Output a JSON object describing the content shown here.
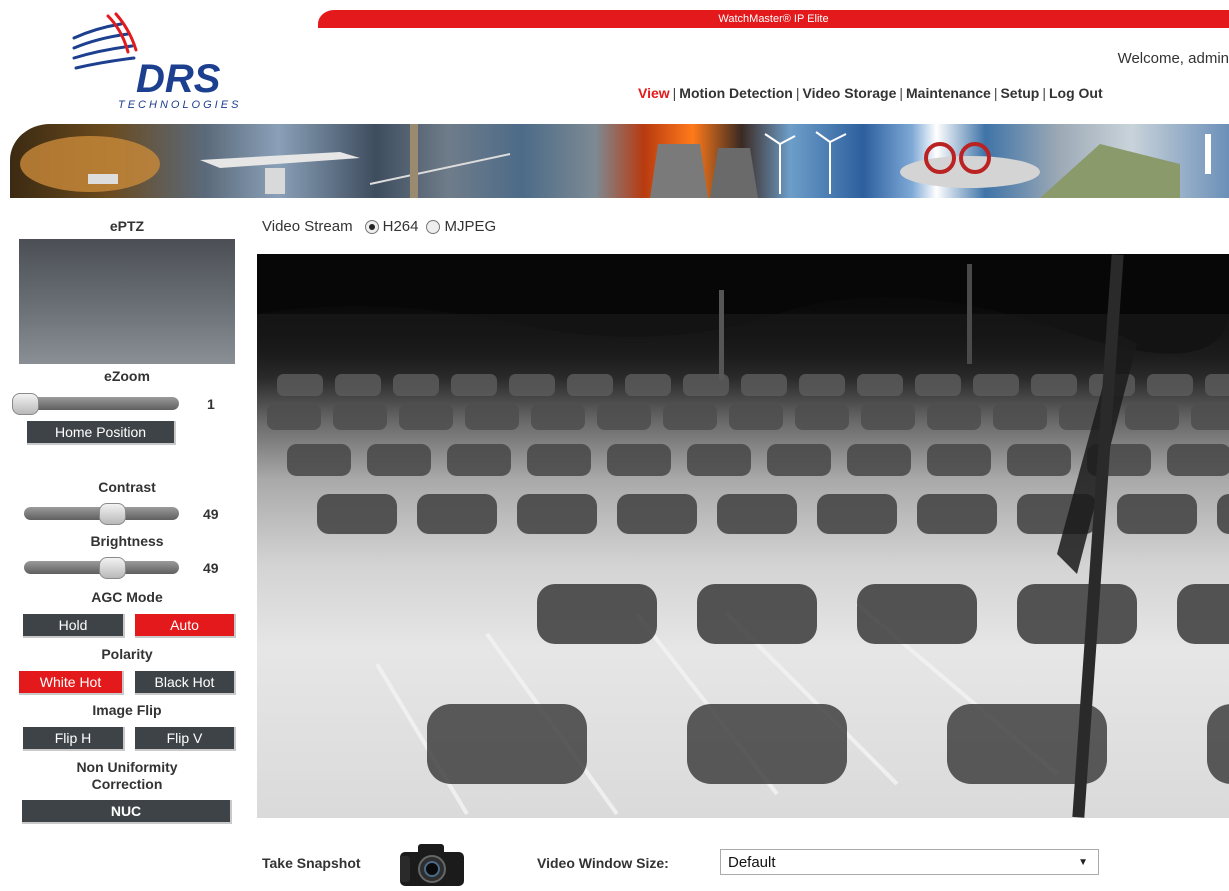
{
  "header": {
    "app_title": "WatchMaster® IP Elite",
    "welcome_text": "Welcome, admin",
    "logo_text": "DRS",
    "logo_subtext": "TECHNOLOGIES",
    "nav": [
      {
        "label": "View",
        "active": true
      },
      {
        "label": "Motion Detection",
        "active": false
      },
      {
        "label": "Video Storage",
        "active": false
      },
      {
        "label": "Maintenance",
        "active": false
      },
      {
        "label": "Setup",
        "active": false
      },
      {
        "label": "Log Out",
        "active": false
      }
    ],
    "nav_separator": "|"
  },
  "left_panel": {
    "eptz_label": "ePTZ",
    "ezoom": {
      "label": "eZoom",
      "value": "1",
      "level": 0.0
    },
    "home_button": "Home Position",
    "contrast": {
      "label": "Contrast",
      "value": "49",
      "level": 0.49
    },
    "brightness": {
      "label": "Brightness",
      "value": "49",
      "level": 0.49
    },
    "agc": {
      "label": "AGC Mode",
      "options": [
        "Hold",
        "Auto"
      ],
      "selected": "Auto"
    },
    "polarity": {
      "label": "Polarity",
      "options": [
        "White Hot",
        "Black Hot"
      ],
      "selected": "White Hot"
    },
    "image_flip": {
      "label": "Image Flip",
      "options": [
        "Flip H",
        "Flip V"
      ]
    },
    "nuc": {
      "label_line1": "Non Uniformity",
      "label_line2": "Correction",
      "button": "NUC"
    }
  },
  "video": {
    "stream_label": "Video Stream",
    "stream_options": [
      "H264",
      "MJPEG"
    ],
    "stream_selected": "H264"
  },
  "footer": {
    "snapshot_label": "Take Snapshot",
    "window_size_label": "Video Window Size:",
    "window_size_value": "Default"
  },
  "colors": {
    "accent": "#e3191b",
    "button": "#3d4347",
    "logo_blue": "#1d3f8f"
  },
  "icons": {
    "logo": "drs-swoosh-logo",
    "snapshot": "camera-icon",
    "dropdown": "chevron-down-icon"
  }
}
